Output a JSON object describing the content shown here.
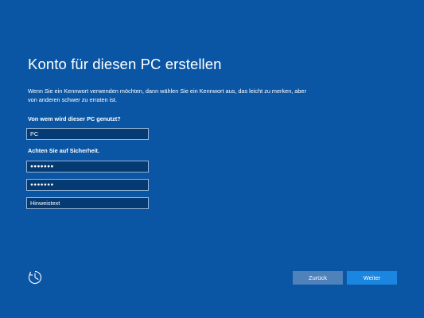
{
  "page": {
    "title": "Konto für diesen PC erstellen",
    "intro": "Wenn Sie ein Kennwort verwenden möchten, dann wählen Sie ein Kennwort aus, das leicht zu merken, aber von anderen schwer zu erraten ist."
  },
  "form": {
    "user_label": "Von wem wird dieser PC genutzt?",
    "user_value": "PC",
    "security_label": "Achten Sie auf Sicherheit.",
    "password_mask": "●●●●●●●",
    "password_confirm_mask": "●●●●●●●",
    "hint_placeholder": "Hinweistext"
  },
  "footer": {
    "ease_of_access_icon": "ease-of-access-icon",
    "back_label": "Zurück",
    "next_label": "Weiter"
  },
  "colors": {
    "background": "#0b56a4",
    "field_background": "#063a73",
    "field_border": "#93b3d5",
    "back_button": "#4f81bb",
    "next_button": "#1a86e0"
  }
}
